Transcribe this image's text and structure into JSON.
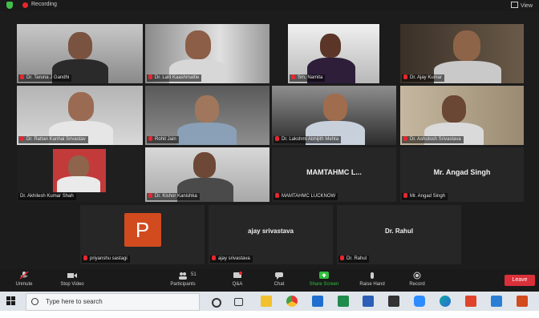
{
  "topbar": {
    "recording_label": "Recording",
    "view_label": "View"
  },
  "tiles": [
    {
      "name": "Dr. Taruna J Gandhi"
    },
    {
      "name": "Dr. Lalit Kaashmattie"
    },
    {
      "name": "Sm. Namita"
    },
    {
      "name": "Dr. Ajay Kumar"
    },
    {
      "name": "Dr. Rattan Kanhai Srivastav"
    },
    {
      "name": "Rohit Jain"
    },
    {
      "name": "Dr. Lakshmi Abhijith Mehta"
    },
    {
      "name": "Dr. Ashutosh Srivastava"
    },
    {
      "name": "Dr. Akhilesh Kumar Shah"
    },
    {
      "name": "Dr. Kishor Kanishka"
    },
    {
      "name": "MAMTAHMC LUCKNOW",
      "big": "MAMTAHMC L..."
    },
    {
      "name": "Mr. Angad Singh",
      "big": "Mr. Angad Singh"
    },
    {
      "name": "priyanshu sastagi",
      "avatar": "P"
    },
    {
      "name": "ajay srivastava",
      "big": "ajay srivastava"
    },
    {
      "name": "Dr. Rahul",
      "big": "Dr. Rahul"
    }
  ],
  "toolbar": {
    "unmute": "Unmute",
    "stop_video": "Stop Video",
    "participants": "Participants",
    "participants_count": "51",
    "qa": "Q&A",
    "chat": "Chat",
    "share_screen": "Share Screen",
    "raise_hand": "Raise Hand",
    "record": "Record",
    "leave": "Leave"
  },
  "taskbar": {
    "search_placeholder": "Type here to search"
  }
}
